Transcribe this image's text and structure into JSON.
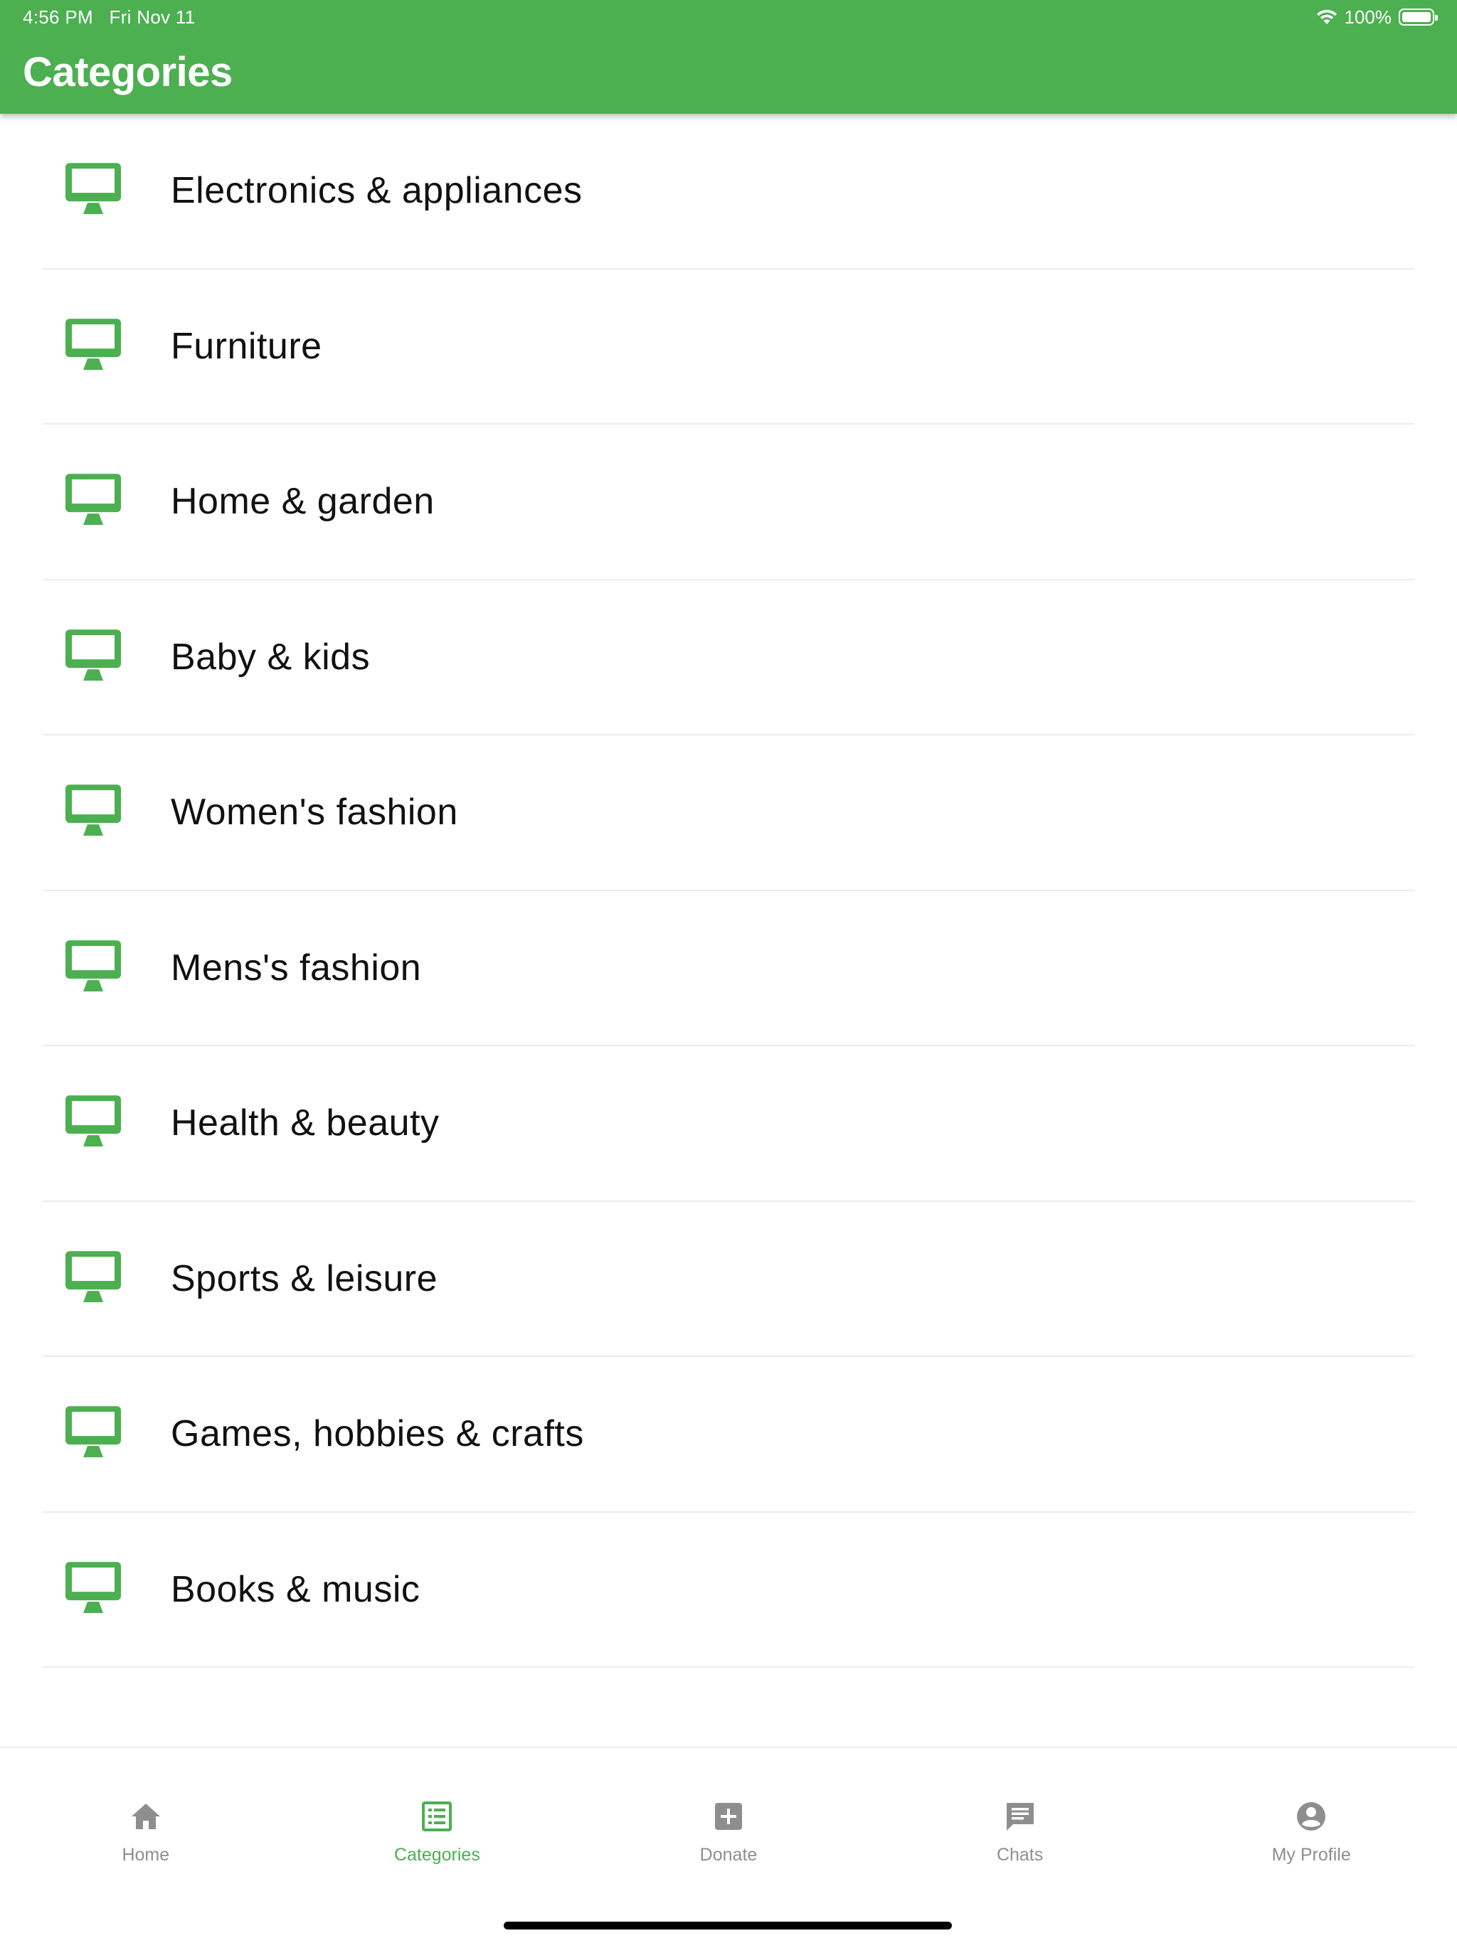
{
  "status_bar": {
    "time": "4:56 PM",
    "date": "Fri Nov 11",
    "battery": "100%",
    "wifi_icon": "wifi-icon",
    "battery_level": 1.0
  },
  "header": {
    "title": "Categories",
    "background_color": "#4caf50"
  },
  "categories": [
    {
      "label": "Electronics & appliances",
      "icon": "monitor-icon"
    },
    {
      "label": "Furniture",
      "icon": "monitor-icon"
    },
    {
      "label": "Home & garden",
      "icon": "monitor-icon"
    },
    {
      "label": "Baby & kids",
      "icon": "monitor-icon"
    },
    {
      "label": "Women's fashion",
      "icon": "monitor-icon"
    },
    {
      "label": "Mens's fashion",
      "icon": "monitor-icon"
    },
    {
      "label": "Health & beauty",
      "icon": "monitor-icon"
    },
    {
      "label": "Sports & leisure",
      "icon": "monitor-icon"
    },
    {
      "label": "Games, hobbies & crafts",
      "icon": "monitor-icon"
    },
    {
      "label": "Books & music",
      "icon": "monitor-icon"
    }
  ],
  "tabbar": {
    "active_color": "#4caf50",
    "inactive_color": "#8e8e8e",
    "tabs": [
      {
        "label": "Home",
        "icon": "home-icon",
        "active": false
      },
      {
        "label": "Categories",
        "icon": "list-icon",
        "active": true
      },
      {
        "label": "Donate",
        "icon": "plus-box-icon",
        "active": false
      },
      {
        "label": "Chats",
        "icon": "chat-icon",
        "active": false
      },
      {
        "label": "My Profile",
        "icon": "account-circle-icon",
        "active": false
      }
    ]
  }
}
